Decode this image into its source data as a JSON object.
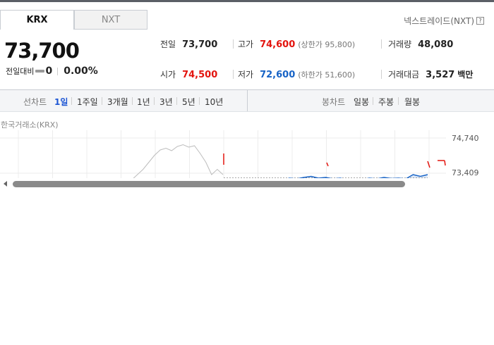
{
  "tabs": [
    "KRX",
    "NXT"
  ],
  "nxt_link": "넥스트레이드(NXT)",
  "help_glyph": "?",
  "price": "73,700",
  "change": {
    "label": "전일대비",
    "value": "0",
    "percent": "0.00%"
  },
  "info": {
    "prev_close": {
      "label": "전일",
      "value": "73,700"
    },
    "high": {
      "label": "고가",
      "value": "74,600",
      "sub": "(상한가 95,800)"
    },
    "volume": {
      "label": "거래량",
      "value": "48,080"
    },
    "open": {
      "label": "시가",
      "value": "74,500"
    },
    "low": {
      "label": "저가",
      "value": "72,600",
      "sub": "(하한가 51,600)"
    },
    "amount": {
      "label": "거래대금",
      "value": "3,527",
      "unit": "백만"
    }
  },
  "periods": {
    "label": "선차트",
    "items": [
      "1일",
      "1주일",
      "3개월",
      "1년",
      "3년",
      "5년",
      "10년"
    ],
    "active": "1일"
  },
  "candle": {
    "label": "봉차트",
    "items": [
      "일봉",
      "주봉",
      "월봉"
    ]
  },
  "exchange_label": "한국거래소(KRX)",
  "colors": {
    "up": "#e3140e",
    "down": "#1763c6",
    "active": "#1d56d4"
  },
  "chart_data": {
    "type": "line",
    "y_tick_labels": [
      "74,740",
      "73,409"
    ],
    "series": [
      {
        "values": [
          73200,
          73250,
          73150,
          73300,
          73350,
          73200,
          73450,
          73550,
          73700,
          73850,
          74050,
          74250,
          74400,
          74450,
          74380,
          74500,
          74550,
          74480,
          74520,
          74300,
          74050,
          73700,
          73850,
          73700
        ]
      },
      {
        "values": [
          73450,
          73300,
          73350,
          73150,
          73250,
          73300,
          73380,
          73450,
          73520,
          73600,
          73580,
          73620,
          73650,
          73600,
          73620,
          73580,
          73600,
          73550,
          73580,
          73560,
          73600,
          73580,
          73620,
          73590,
          73600,
          73580,
          73700,
          73650,
          73700
        ]
      }
    ]
  }
}
